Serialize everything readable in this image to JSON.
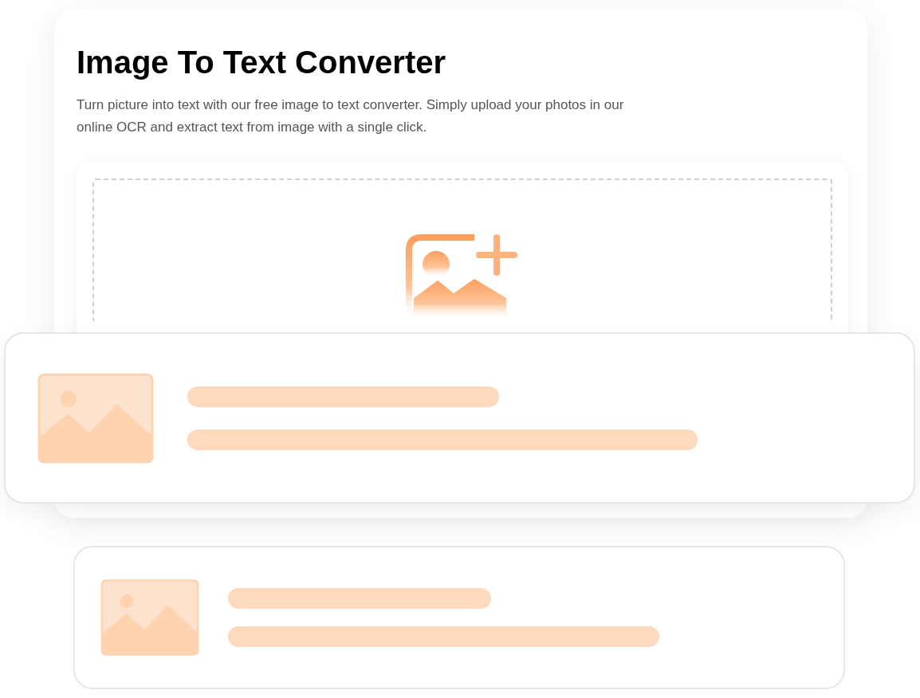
{
  "header": {
    "title": "Image To Text Converter",
    "description": "Turn picture into text with our free image to text converter. Simply upload your photos in our online OCR and extract text from image with a single click."
  }
}
